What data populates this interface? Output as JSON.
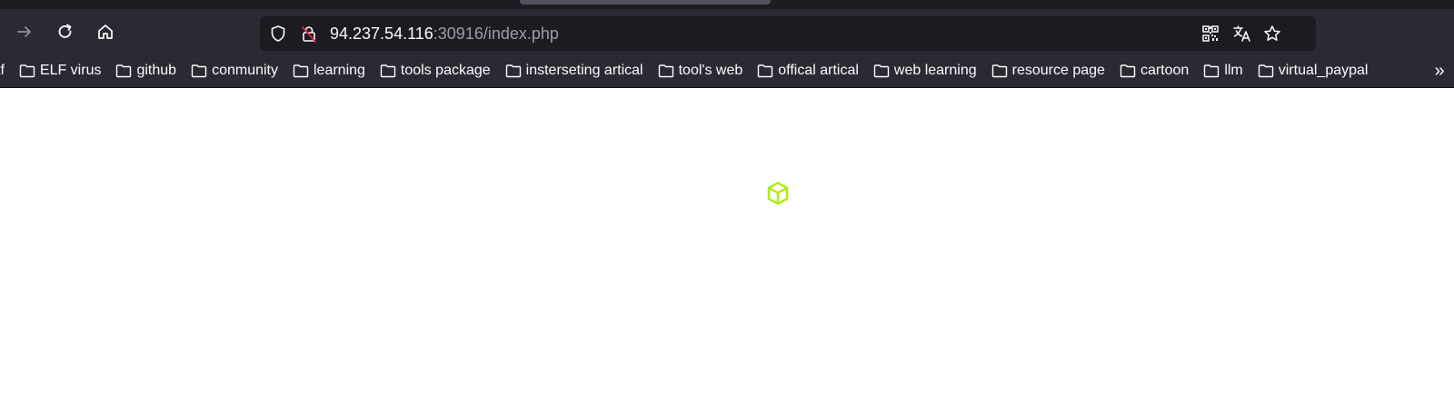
{
  "browser": {
    "url": {
      "host": "94.237.54.116",
      "rest": ":30916/index.php"
    },
    "nav_icons": [
      "forward-arrow-icon",
      "reload-icon",
      "home-icon"
    ],
    "urlbar_icons": [
      "shield-icon",
      "insecure-lock-icon",
      "qr-code-icon",
      "translate-icon",
      "star-icon"
    ]
  },
  "bookmarks": [
    {
      "label": "tf",
      "icon": "none"
    },
    {
      "label": "ELF virus",
      "icon": "folder-icon"
    },
    {
      "label": "github",
      "icon": "folder-icon"
    },
    {
      "label": "conmunity",
      "icon": "folder-icon"
    },
    {
      "label": "learning",
      "icon": "folder-icon"
    },
    {
      "label": "tools package",
      "icon": "folder-icon"
    },
    {
      "label": "insterseting artical",
      "icon": "folder-icon"
    },
    {
      "label": "tool's web",
      "icon": "folder-icon"
    },
    {
      "label": "offical artical",
      "icon": "folder-icon"
    },
    {
      "label": "web learning",
      "icon": "folder-icon"
    },
    {
      "label": "resource page",
      "icon": "folder-icon"
    },
    {
      "label": "cartoon",
      "icon": "folder-icon"
    },
    {
      "label": "llm",
      "icon": "folder-icon"
    },
    {
      "label": "virtual_paypal",
      "icon": "folder-icon"
    }
  ],
  "bookmarks_overflow": "»",
  "page": {
    "loader_icon": "cube-icon",
    "loader_color": "#aaee00"
  }
}
